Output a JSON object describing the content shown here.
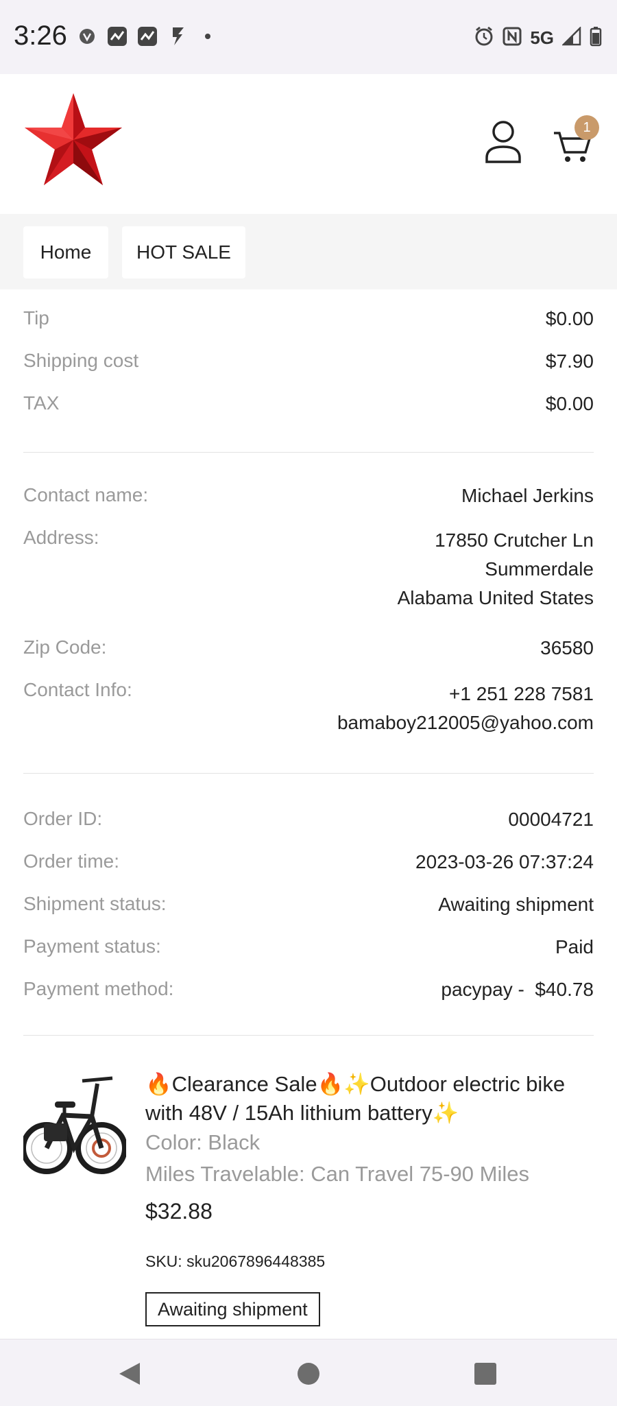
{
  "status_bar": {
    "time": "3:26",
    "network": "5G",
    "left_icons": [
      "app-icon",
      "stocks-icon",
      "stocks-icon",
      "bolt-icon",
      "dot-icon"
    ],
    "right_icons": [
      "alarm-icon",
      "nfc-icon",
      "signal-icon",
      "battery-icon"
    ]
  },
  "header": {
    "logo_icon": "red-star-icon",
    "cart_count": "1",
    "accent_color": "#c99a6a"
  },
  "nav": {
    "items": [
      {
        "label": "Home"
      },
      {
        "label": "HOT SALE"
      }
    ]
  },
  "summary": {
    "tip_label": "Tip",
    "tip_value": "$0.00",
    "shipping_label": "Shipping cost",
    "shipping_value": "$7.90",
    "tax_label": "TAX",
    "tax_value": "$0.00"
  },
  "contact": {
    "name_label": "Contact name:",
    "name_value": "Michael Jerkins",
    "address_label": "Address:",
    "address_line1": "17850 Crutcher Ln",
    "address_line2": "Summerdale",
    "address_line3": "Alabama United States",
    "zip_label": "Zip Code:",
    "zip_value": "36580",
    "info_label": "Contact Info:",
    "phone": "+1 251 228 7581",
    "email": "bamaboy212005@yahoo.com"
  },
  "order": {
    "id_label": "Order ID:",
    "id_value": "00004721",
    "time_label": "Order time:",
    "time_value": "2023-03-26 07:37:24",
    "shipment_label": "Shipment status:",
    "shipment_value": "Awaiting shipment",
    "payment_status_label": "Payment status:",
    "payment_status_value": "Paid",
    "payment_method_label": "Payment method:",
    "payment_method_value": "pacypay -  $40.78"
  },
  "product": {
    "title": "🔥Clearance Sale🔥✨Outdoor electric bike with 48V / 15Ah lithium battery✨",
    "color": "Color: Black",
    "miles": "Miles Travelable: Can Travel 75-90 Miles",
    "price": "$32.88",
    "sku": "SKU: sku2067896448385",
    "status": "Awaiting shipment"
  }
}
